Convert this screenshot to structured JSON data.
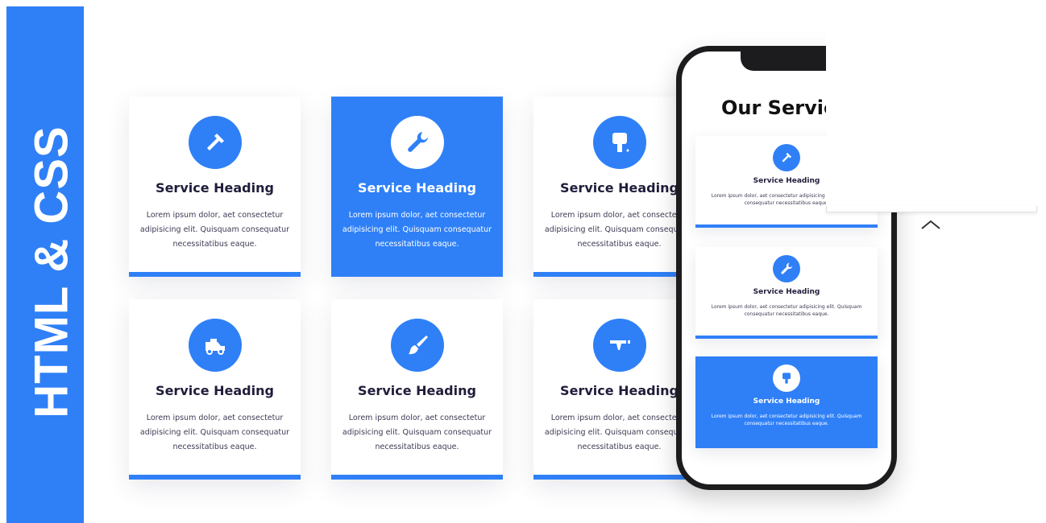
{
  "banner": {
    "text": "HTML & CSS",
    "color": "#2f80f7"
  },
  "cards": [
    {
      "icon": "hammer-icon",
      "heading": "Service Heading",
      "text": "Lorem ipsum dolor, aet consectetur adipisicing elit. Quisquam consequatur necessitatibus eaque.",
      "active": false
    },
    {
      "icon": "wrench-icon",
      "heading": "Service Heading",
      "text": "Lorem ipsum dolor, aet consectetur adipisicing elit. Quisquam consequatur necessitatibus eaque.",
      "active": true
    },
    {
      "icon": "paint-roller-icon",
      "heading": "Service Heading",
      "text": "Lorem ipsum dolor, aet consectetur adipisicing elit. Quisquam consequatur necessitatibus eaque.",
      "active": false
    },
    {
      "icon": "truck-icon",
      "heading": "Service Heading",
      "text": "Lorem ipsum dolor, aet consectetur adipisicing elit. Quisquam consequatur necessitatibus eaque.",
      "active": false
    },
    {
      "icon": "brush-icon",
      "heading": "Service Heading",
      "text": "Lorem ipsum dolor, aet consectetur adipisicing elit. Quisquam consequatur necessitatibus eaque.",
      "active": false
    },
    {
      "icon": "faucet-icon",
      "heading": "Service Heading",
      "text": "Lorem ipsum dolor, aet consectetur adipisicing elit. Quisquam consequatur necessitatibus eaque.",
      "active": false
    }
  ],
  "phone": {
    "title": "Our Services",
    "cards": [
      {
        "icon": "hammer-icon",
        "heading": "Service Heading",
        "text": "Lorem ipsum dolor, aet consectetur adipisicing elit. Quisquam consequatur necessitatibus eaque.",
        "active": false
      },
      {
        "icon": "wrench-icon",
        "heading": "Service Heading",
        "text": "Lorem ipsum dolor, aet consectetur adipisicing elit. Quisquam consequatur necessitatibus eaque.",
        "active": false
      },
      {
        "icon": "paint-roller-icon",
        "heading": "Service Heading",
        "text": "Lorem ipsum dolor, aet consectetur adipisicing elit. Quisquam consequatur necessitatibus eaque.",
        "active": true
      }
    ]
  },
  "scroll": {
    "icon": "chevron-up-icon"
  }
}
